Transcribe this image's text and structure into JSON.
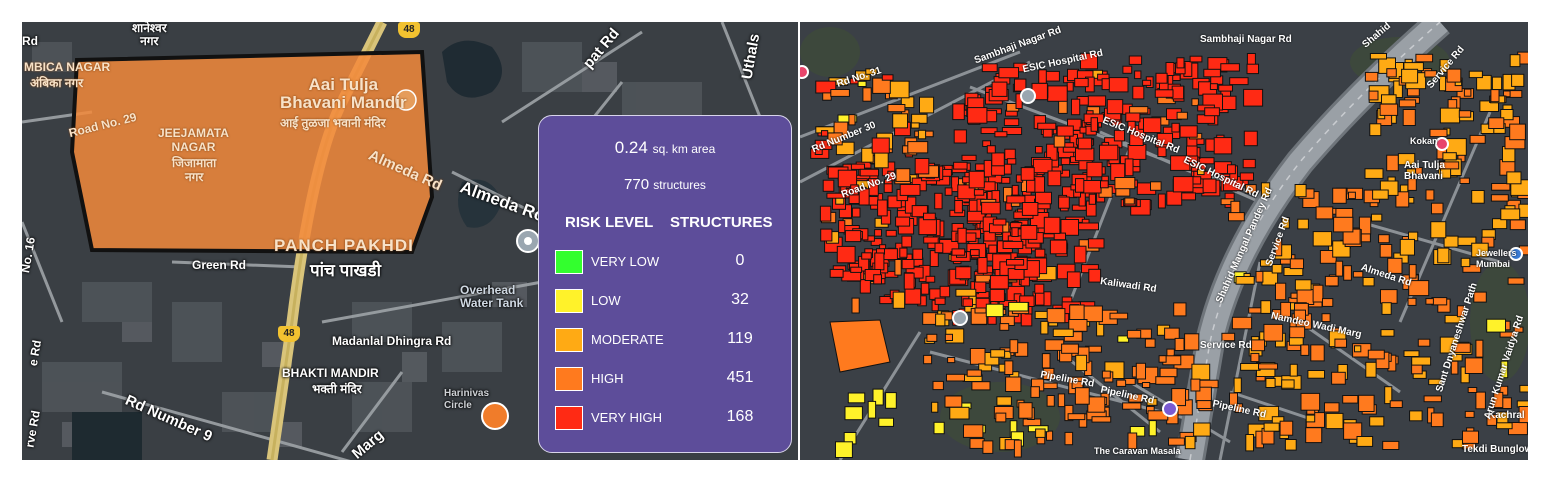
{
  "left_map": {
    "labels": {
      "top_nagar": "शानेश्वर\nनगर",
      "ambica_en": "MBICA NAGAR",
      "ambica_hi": "अंबिका नगर",
      "road29": "Road No. 29",
      "jeejamata_en": "JEEJAMATA\nNAGAR",
      "jeejamata_hi": "जिजामाता\nनगर",
      "aai_en": "Aai Tulja\nBhavani Mandir",
      "aai_hi": "आई तुळजा भवानी मंदिर",
      "almeda1": "Almeda Rd",
      "almeda2": "Almeda Ro",
      "panch_en": "PANCH PAKHDI",
      "panch_hi": "पांच पाखडी",
      "green": "Green Rd",
      "madanlal": "Madanlal Dhingra Rd",
      "bhakti_en": "BHAKTI MANDIR",
      "bhakti_hi": "भक्ती मंदिर",
      "rd9": "Rd Number 9",
      "marg": "Marg",
      "overhead": "Overhead\nWater Tank",
      "patrd": "pat Rd",
      "uthals": "Uthals",
      "rdno16": "No. 16",
      "rd_left": "Rd",
      "erd": "e Rd",
      "rverd": "rve Rd",
      "harinivas": "Harinivas\nCircle",
      "rdtop": "Rd"
    },
    "shield_top": "48",
    "shield_mid": "48"
  },
  "legend": {
    "area_value": "0.24",
    "area_unit": "sq. km area",
    "structures_value": "770",
    "structures_unit": "structures",
    "col_risk": "RISK LEVEL",
    "col_structures": "STRUCTURES",
    "rows": [
      {
        "label": "VERY LOW",
        "count": "0",
        "color": "#33ff2e"
      },
      {
        "label": "LOW",
        "count": "32",
        "color": "#fff22a"
      },
      {
        "label": "MODERATE",
        "count": "119",
        "color": "#ffaa14"
      },
      {
        "label": "HIGH",
        "count": "451",
        "color": "#ff7a1e"
      },
      {
        "label": "VERY HIGH",
        "count": "168",
        "color": "#ff2a14"
      }
    ]
  },
  "right_map": {
    "labels": {
      "sambhaji1": "Sambhaji Nagar Rd",
      "sambhaji2": "Sambhaji Nagar Rd",
      "esic1": "ESIC Hospital Rd",
      "esic2": "ESIC Hospital Rd",
      "esic3": "ESIC Hospital Rd",
      "rdno31": "Rd No. 31",
      "rdnum30": "Rd Number 30",
      "road29": "Road No. 29",
      "shahid": "Shahid",
      "service1": "Service Rd",
      "service2": "Service Rd",
      "service3": "Service Rd",
      "almeda": "Almeda Rd",
      "kalwadi": "Kaliwadi Rd",
      "shahidmarg": "Shahid Mangal Pandey Rd",
      "namdeo": "Namdeo Wadi Marg",
      "pipeline1": "Pipeline Rd",
      "pipeline2": "Pipeline Rd",
      "pipeline3": "Pipeline Rd",
      "tekdi": "Tekdi Bunglow",
      "kachral": "Kachral",
      "aaitulja": "Aai Tulja\nBhavani",
      "caravan": "The Caravan Masala",
      "sant": "Sant Dnyaneshwar Path",
      "arun": "Arun Kumar Vaidya Rd",
      "jewellers": "Jewellers\nMumbai",
      "kokan": "Kokan"
    }
  }
}
